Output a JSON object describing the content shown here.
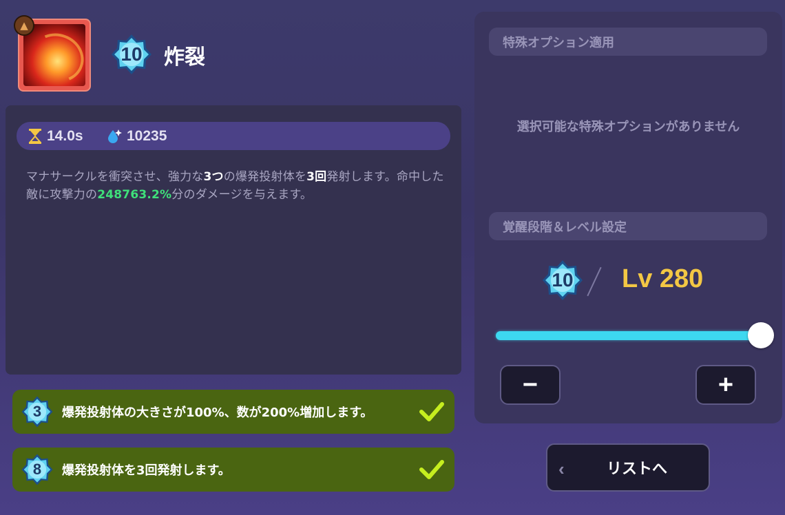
{
  "skill": {
    "name": "炸裂",
    "level_badge": "10",
    "icon": "explosion-skill-icon",
    "corner_icon": "stone-tier-icon"
  },
  "stats": {
    "cooldown": "14.0s",
    "mana_cost": "10235"
  },
  "description": {
    "p1": "マナサークルを衝突させ、強力な",
    "b1": "3つ",
    "p2": "の爆発投射体を",
    "b2": "3回",
    "p3": "発射します。命中した敵に攻撃力の",
    "highlight": "248763.2%",
    "p4": "分のダメージを与えます。"
  },
  "awakenings": [
    {
      "level": "3",
      "text": "爆発投射体の大きさが100%、数が200%増加します。",
      "achieved": true
    },
    {
      "level": "8",
      "text": "爆発投射体を3回発射します。",
      "achieved": true
    }
  ],
  "special_option": {
    "header": "特殊オプション適用",
    "empty_text": "選択可能な特殊オプションがありません"
  },
  "level_setting": {
    "header": "覚醒段階＆レベル設定",
    "awakening": "10",
    "level_label": "Lv 280",
    "slider_fraction": 1.0,
    "minus_label": "−",
    "plus_label": "+"
  },
  "back_button": {
    "label": "リストへ",
    "chevron": "‹"
  },
  "colors": {
    "accent_cyan": "#3dd8f0",
    "level_gold": "#f3c744",
    "awakening_green": "#4a6511",
    "check_lime": "#c6ee1f",
    "highlight_green": "#3fe07a"
  }
}
